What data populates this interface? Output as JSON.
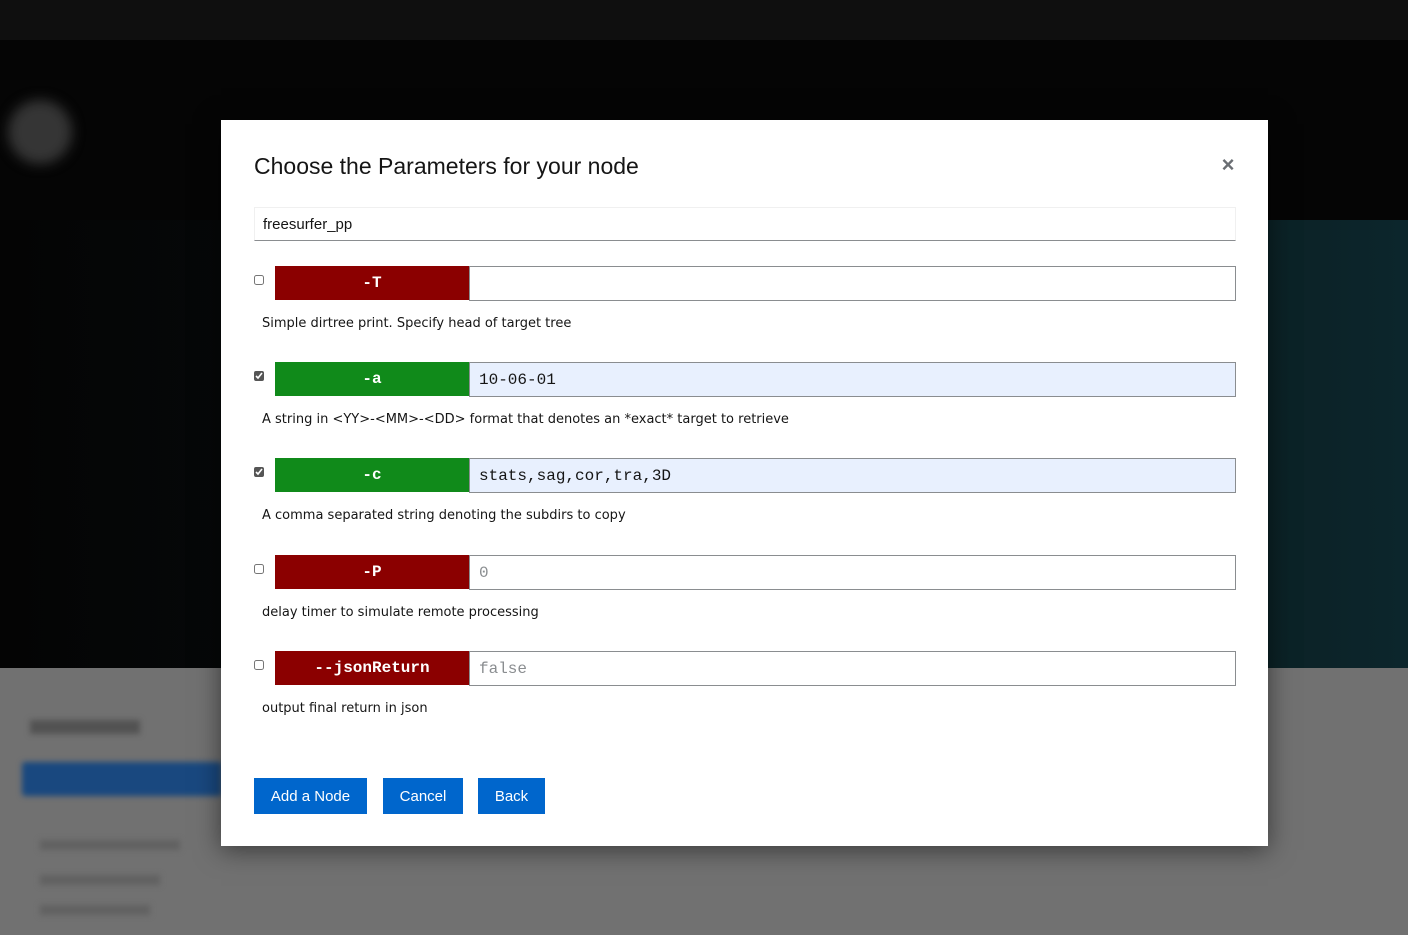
{
  "modal": {
    "title": "Choose the Parameters for your node",
    "close_icon": "×",
    "plugin_name": "freesurfer_pp"
  },
  "parameters": [
    {
      "flag": "-T",
      "checked": false,
      "value": "",
      "placeholder": "",
      "description": "Simple dirtree print. Specify head of target tree",
      "flag_color": "#8b0000"
    },
    {
      "flag": "-a",
      "checked": true,
      "value": "10-06-01",
      "placeholder": "",
      "description": "A string in <YY>-<MM>-<DD> format that denotes an *exact* target to retrieve",
      "flag_color": "#108a1a"
    },
    {
      "flag": "-c",
      "checked": true,
      "value": "stats,sag,cor,tra,3D",
      "placeholder": "",
      "description": "A comma separated string denoting the subdirs to copy",
      "flag_color": "#108a1a"
    },
    {
      "flag": "-P",
      "checked": false,
      "value": "",
      "placeholder": "0",
      "description": "delay timer to simulate remote processing",
      "flag_color": "#8b0000"
    },
    {
      "flag": "--jsonReturn",
      "checked": false,
      "value": "",
      "placeholder": "false",
      "description": "output final return in json",
      "flag_color": "#8b0000"
    }
  ],
  "buttons": {
    "add_node": "Add a Node",
    "cancel": "Cancel",
    "back": "Back"
  },
  "colors": {
    "primary": "#0066cc",
    "flag_unchecked": "#8b0000",
    "flag_checked": "#108a1a"
  }
}
